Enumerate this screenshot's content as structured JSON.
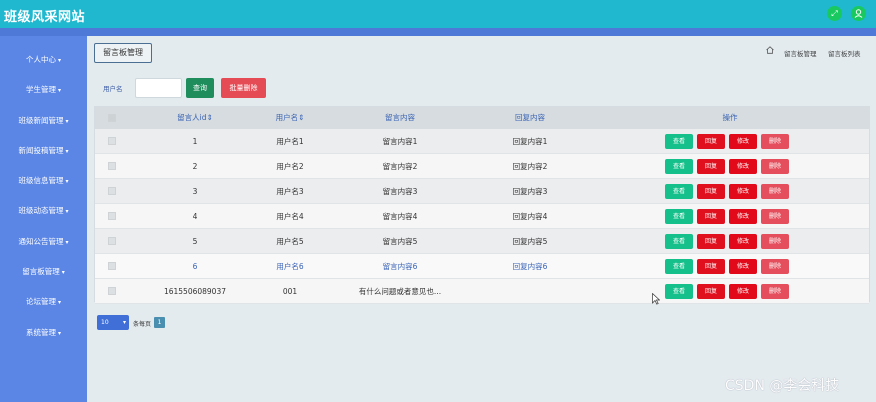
{
  "app": {
    "title": "班级风采网站",
    "icons": [
      "expand-icon",
      "user-icon"
    ]
  },
  "sidebar": {
    "items": [
      {
        "label": "个人中心"
      },
      {
        "label": "学生管理"
      },
      {
        "label": "班级新闻管理"
      },
      {
        "label": "新闻投稿管理"
      },
      {
        "label": "班级信息管理"
      },
      {
        "label": "班级动态管理"
      },
      {
        "label": "通知公告管理"
      },
      {
        "label": "留言板管理"
      },
      {
        "label": "论坛管理"
      },
      {
        "label": "系统管理"
      }
    ]
  },
  "header": {
    "module_button": "留言板管理",
    "breadcrumb": [
      "留言板管理",
      "留言板列表"
    ]
  },
  "search": {
    "label": "用户名",
    "value": "",
    "query_label": "查询",
    "batch_delete_label": "批量删除"
  },
  "table": {
    "columns": [
      "留言人id",
      "用户名",
      "留言内容",
      "回复内容",
      "操作"
    ],
    "actions": [
      "查看",
      "回复",
      "修改",
      "删除"
    ],
    "rows": [
      {
        "id": "1",
        "username": "用户名1",
        "content": "留言内容1",
        "reply": "回复内容1"
      },
      {
        "id": "2",
        "username": "用户名2",
        "content": "留言内容2",
        "reply": "回复内容2"
      },
      {
        "id": "3",
        "username": "用户名3",
        "content": "留言内容3",
        "reply": "回复内容3"
      },
      {
        "id": "4",
        "username": "用户名4",
        "content": "留言内容4",
        "reply": "回复内容4"
      },
      {
        "id": "5",
        "username": "用户名5",
        "content": "留言内容5",
        "reply": "回复内容5"
      },
      {
        "id": "6",
        "username": "用户名6",
        "content": "留言内容6",
        "reply": "回复内容6"
      },
      {
        "id": "1615506089037",
        "username": "001",
        "content": "有什么问题或者意见也...",
        "reply": ""
      }
    ]
  },
  "pager": {
    "page_size": "10",
    "per_page_label": "条每页",
    "current_page": "1"
  },
  "watermark": "CSDN @李会科技",
  "colors": {
    "topbar": "#1fb8cf",
    "sidebar": "#5b86e6",
    "view": "#16c08a",
    "reply": "#e0101f",
    "edit": "#e1091a",
    "delete": "#e54e5c"
  }
}
